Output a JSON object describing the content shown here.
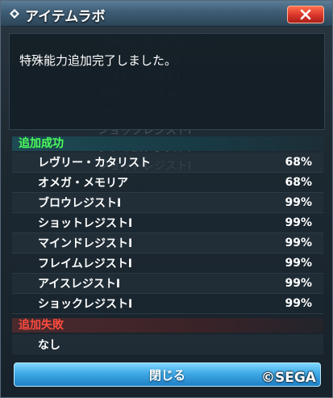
{
  "window": {
    "title": "アイテムラボ",
    "close_icon": "close-x-icon",
    "title_icon": "diamond-icon"
  },
  "message": "特殊能力追加完了しました。",
  "background_ghost": [
    "特殊能力追加可能リスト",
    "アイスレジストI",
    "ライトレジストI",
    "ダウンレジストI",
    "オールレジストI",
    "ショックレジストI",
    "フレイムレジストI",
    "ショットレジストI"
  ],
  "success": {
    "header": "追加成功",
    "items": [
      {
        "name": "レヴリー・カタリスト",
        "rate": "68%"
      },
      {
        "name": "オメガ・メモリア",
        "rate": "68%"
      },
      {
        "name": "ブロウレジストI",
        "rate": "99%"
      },
      {
        "name": "ショットレジストI",
        "rate": "99%"
      },
      {
        "name": "マインドレジストI",
        "rate": "99%"
      },
      {
        "name": "フレイムレジストI",
        "rate": "99%"
      },
      {
        "name": "アイスレジストI",
        "rate": "99%"
      },
      {
        "name": "ショックレジストI",
        "rate": "99%"
      }
    ]
  },
  "failure": {
    "header": "追加失敗",
    "items": [
      "なし"
    ]
  },
  "buttons": {
    "close_label": "閉じる"
  },
  "copyright": "©SEGA",
  "colors": {
    "success": "#4cff5a",
    "failure": "#ff4a3d",
    "button": "#3fa9e6",
    "close": "#d9352a"
  }
}
